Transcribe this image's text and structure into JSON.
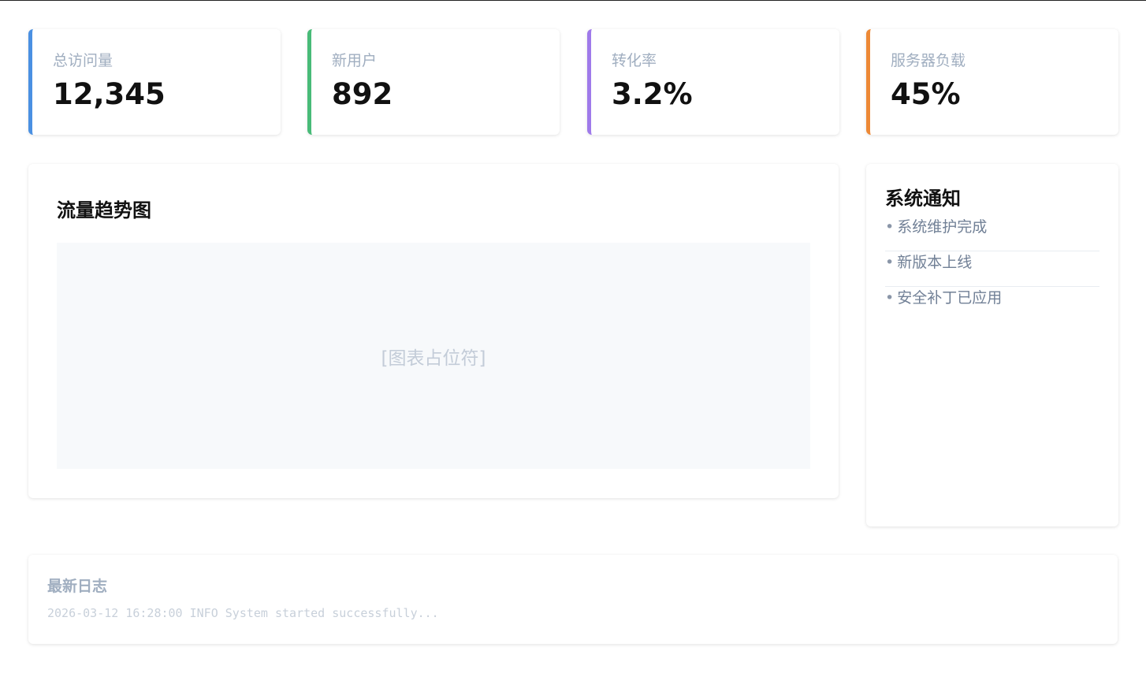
{
  "stats": [
    {
      "label": "总访问量",
      "value": "12,345",
      "accent": "#4a90e2"
    },
    {
      "label": "新用户",
      "value": "892",
      "accent": "#48bb78"
    },
    {
      "label": "转化率",
      "value": "3.2%",
      "accent": "#9f7aea"
    },
    {
      "label": "服务器负载",
      "value": "45%",
      "accent": "#ed8936"
    }
  ],
  "chart": {
    "title": "流量趋势图",
    "placeholder": "[图表占位符]"
  },
  "notices": {
    "title": "系统通知",
    "bullet": "•",
    "items": [
      "系统维护完成",
      "新版本上线",
      "安全补丁已应用"
    ]
  },
  "log": {
    "title": "最新日志",
    "line": "2026-03-12 16:28:00 INFO System started successfully..."
  }
}
